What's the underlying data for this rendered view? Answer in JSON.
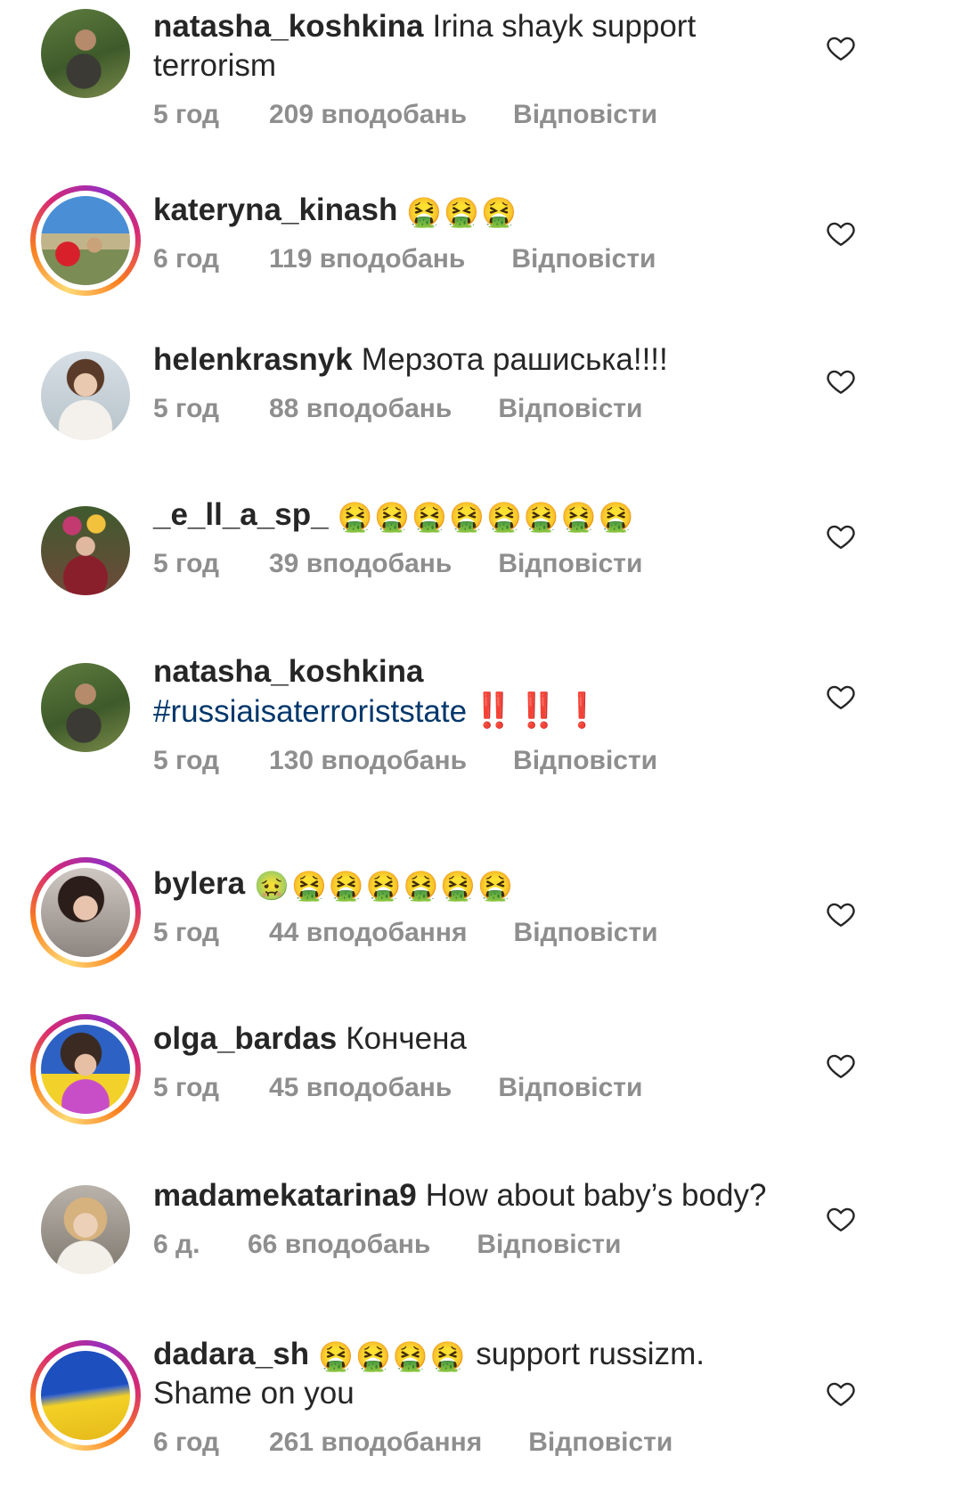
{
  "comments": [
    {
      "username": "natasha_koshkina",
      "text_line1": "Irina shayk support",
      "text_line2": "terrorism",
      "emoji": "",
      "time": "5 год",
      "likes": "209 вподобань",
      "reply": "Відповісти",
      "avatar": "avatar-natasha-photo",
      "story_ring": false
    },
    {
      "username": "kateryna_kinash",
      "text_line1": "",
      "emoji": "🤮🤮🤮",
      "time": "6 год",
      "likes": "119 вподобань",
      "reply": "Відповісти",
      "avatar": "avatar-kateryna-photo",
      "story_ring": true
    },
    {
      "username": "helenkrasnyk",
      "text_line1": "Мерзота рашиська!!!!",
      "emoji": "",
      "time": "5 год",
      "likes": "88 вподобань",
      "reply": "Відповісти",
      "avatar": "avatar-helen-photo",
      "story_ring": false
    },
    {
      "username": "_e_ll_a_sp_",
      "text_line1": "",
      "emoji": "🤮🤮🤮🤮🤮🤮🤮🤮",
      "time": "5 год",
      "likes": "39 вподобань",
      "reply": "Відповісти",
      "avatar": "avatar-ella-photo",
      "story_ring": false
    },
    {
      "username": "natasha_koshkina",
      "hashtag": "#russiaisaterroriststate",
      "bangs": "‼️ ‼️ ❗",
      "time": "5 год",
      "likes": "130 вподобань",
      "reply": "Відповісти",
      "avatar": "avatar-natasha-photo",
      "story_ring": false
    },
    {
      "username": "bylera",
      "text_line1": "",
      "emoji": "🤢🤮🤮🤮🤮🤮🤮",
      "time": "5 год",
      "likes": "44 вподобання",
      "reply": "Відповісти",
      "avatar": "avatar-bylera-photo",
      "story_ring": true
    },
    {
      "username": "olga_bardas",
      "text_line1": "Кончена",
      "emoji": "",
      "time": "5 год",
      "likes": "45 вподобань",
      "reply": "Відповісти",
      "avatar": "avatar-olga-photo",
      "story_ring": true
    },
    {
      "username": "madamekatarina9",
      "text_line1": "How about baby’s body?",
      "emoji": "",
      "time": "6 д.",
      "likes": "66 вподобань",
      "reply": "Відповісти",
      "avatar": "avatar-madame-photo",
      "story_ring": false
    },
    {
      "username": "dadara_sh",
      "emoji": "🤮🤮🤮🤮",
      "text_line1": "support russizm.",
      "text_line2": "Shame on you",
      "time": "6 год",
      "likes": "261 вподобання",
      "reply": "Відповісти",
      "avatar": "avatar-ukraine-flag",
      "story_ring": true
    }
  ],
  "icons": {
    "like": "heart-outline-icon"
  },
  "colors": {
    "text": "#262626",
    "meta": "#8e8e8e",
    "hashtag": "#00376b",
    "like_icon": "#262626"
  }
}
